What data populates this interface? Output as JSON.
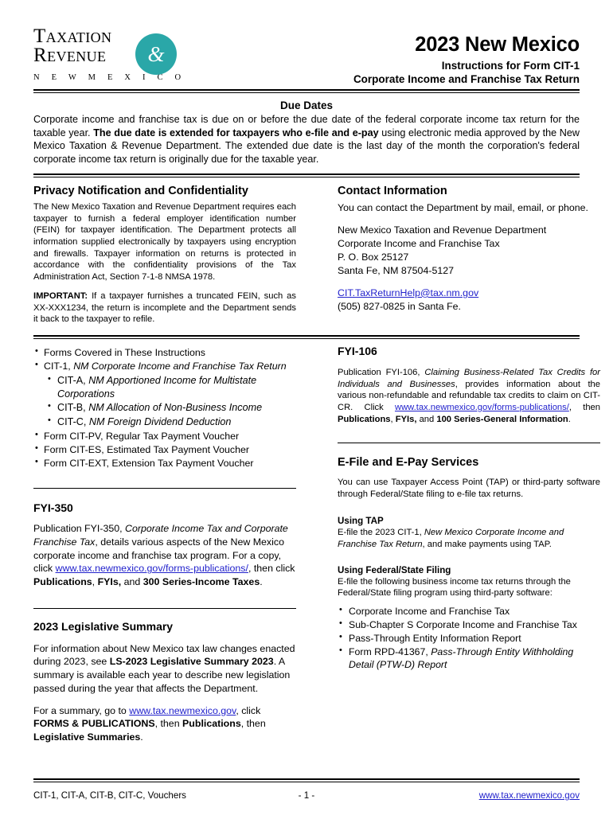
{
  "header": {
    "logo": {
      "line1": "Taxation",
      "line2": "Revenue",
      "ampersand": "&",
      "subtitle": "N E W   M E X I C O",
      "accent_color": "#2aa7a8"
    },
    "title_main": "2023 New Mexico",
    "title_sub1": "Instructions for Form CIT-1",
    "title_sub2": "Corporate Income and Franchise Tax Return"
  },
  "due_dates": {
    "heading": "Due Dates",
    "text_1": "Corporate income and franchise tax is due on or before the due date of the federal corporate income tax return for the taxable year. ",
    "text_bold": "The due date is extended for taxpayers who e-file and e-pay",
    "text_2": " using electronic media approved by the New Mexico Taxation & Revenue Department. The extended due date is the last day of the month the corporation's federal corporate income tax return is originally due for the taxable year."
  },
  "privacy": {
    "heading": "Privacy Notification and Confidentiality",
    "paragraph": "The New Mexico Taxation and Revenue Department requires each taxpayer to furnish a federal employer identification number (FEIN) for taxpayer identification. The Department protects all information supplied electronically by taxpayers using encryption and firewalls. Taxpayer information on returns is protected in accordance with the confidentiality provisions of the Tax Administration Act, Section 7-1-8 NMSA 1978.",
    "important_label": "IMPORTANT:",
    "important_text": " If a taxpayer furnishes a truncated FEIN, such as XX-XXX1234, the return is incomplete and the Department sends it back to the taxpayer to refile."
  },
  "contact": {
    "heading": "Contact Information",
    "intro": "You can contact the Department by mail, email, or phone.",
    "address_line_1": "New Mexico Taxation and Revenue Department",
    "address_line_2": "Corporate Income and Franchise Tax",
    "address_line_3": "P. O. Box 25127",
    "address_line_4": "Santa Fe, NM 87504-5127",
    "email": "CIT.TaxReturnHelp@tax.nm.gov",
    "phone": "(505) 827-0825 in Santa Fe."
  },
  "forms_list": {
    "items": [
      {
        "level": 1,
        "text": "Forms Covered in These Instructions",
        "italic_part": ""
      },
      {
        "level": 1,
        "text": "CIT-1, ",
        "italic_part": "NM Corporate Income and Franchise Tax Return"
      },
      {
        "level": 2,
        "text": "CIT-A, ",
        "italic_part": "NM Apportioned Income for Multistate Corporations"
      },
      {
        "level": 2,
        "text": "CIT-B, ",
        "italic_part": "NM Allocation of Non-Business Income"
      },
      {
        "level": 2,
        "text": "CIT-C, ",
        "italic_part": "NM Foreign Dividend Deduction"
      },
      {
        "level": 1,
        "text": "Form CIT-PV, Regular Tax Payment Voucher",
        "italic_part": ""
      },
      {
        "level": 1,
        "text": "Form CIT-ES, Estimated Tax Payment Voucher",
        "italic_part": ""
      },
      {
        "level": 1,
        "text": "Form CIT-EXT, Extension Tax Payment Voucher",
        "italic_part": ""
      }
    ]
  },
  "fyi_106": {
    "heading": "FYI-106",
    "p_a": "Publication FYI-106, ",
    "p_b_italic": "Claiming Business-Related Tax Credits for Individuals and Businesses",
    "p_c": ", provides information about the various non-refundable and refundable tax credits to claim on CIT-CR. Click ",
    "link": "www.tax.newmexico.gov/forms-publications/",
    "p_d": ", then ",
    "bold_1": "Publications",
    "p_e": ", ",
    "bold_2": "FYIs,",
    "p_f": " and ",
    "bold_3": "100 Series-General Information",
    "p_g": "."
  },
  "efile": {
    "heading": "E-File and E-Pay Services",
    "intro": "You can use Taxpayer Access Point (TAP) or third-party software through Federal/State filing to e-file tax returns.",
    "tap_heading": "Using TAP",
    "tap_a": "E-file the 2023 CIT-1, ",
    "tap_b_italic": "New Mexico Corporate Income and Franchise Tax Return",
    "tap_c": ", and make payments using TAP.",
    "fed_heading": "Using Federal/State Filing",
    "fed_intro": "E-file the following business income tax returns through the Federal/State filing program using third-party software:",
    "items": [
      {
        "text": "Corporate Income and Franchise Tax",
        "italic_part": ""
      },
      {
        "text": "Sub-Chapter S Corporate Income and Franchise Tax",
        "italic_part": ""
      },
      {
        "text": "Pass-Through Entity Information Report",
        "italic_part": ""
      },
      {
        "text": "Form RPD-41367, ",
        "italic_part": "Pass-Through Entity Withholding Detail (PTW-D) Report"
      }
    ]
  },
  "fyi_350": {
    "heading": "FYI-350",
    "p_a": "Publication FYI-350, ",
    "p_b_italic": "Corporate Income Tax and Corporate Franchise Tax",
    "p_c": ", details various aspects of the New Mexico corporate income and franchise tax program. For a copy, click ",
    "link": "www.tax.newmexico.gov/forms-publications/",
    "p_d": ", then click ",
    "bold_1": "Publications",
    "p_e": ", ",
    "bold_2": "FYIs,",
    "p_f": " and ",
    "bold_3": "300 Series-Income Taxes",
    "p_g": "."
  },
  "legislative": {
    "heading": "2023 Legislative Summary",
    "p1_a": "For information about New Mexico tax law changes enacted during 2023, see ",
    "p1_bold": "LS-2023 Legislative Summary 2023",
    "p1_b": ". A summary is available each year to describe new legislation passed during the year that affects the Department.",
    "p2_a": "For a summary, go to ",
    "p2_link": "www.tax.newmexico.gov",
    "p2_b": ", click ",
    "p2_bold1": "FORMS & PUBLICATIONS",
    "p2_c": ", then ",
    "p2_bold2": "Publications",
    "p2_d": ", then ",
    "p2_bold3": "Legislative Summaries",
    "p2_e": "."
  },
  "footer": {
    "left": "CIT-1, CIT-A, CIT-B, CIT-C, Vouchers",
    "page_number": "- 1 -",
    "website": "www.tax.newmexico.gov"
  }
}
